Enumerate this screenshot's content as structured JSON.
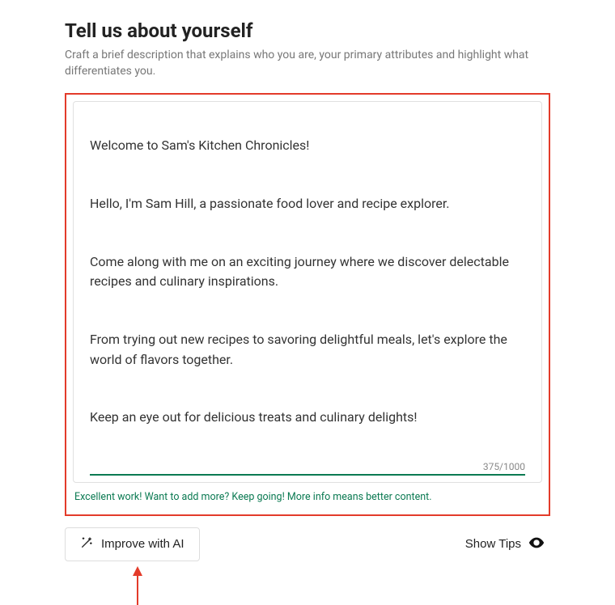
{
  "header": {
    "title": "Tell us about yourself",
    "subtitle": "Craft a brief description that explains who you are, your primary attributes and highlight what differentiates you."
  },
  "editor": {
    "paragraphs": [
      "Welcome to Sam's Kitchen Chronicles!",
      "Hello, I'm Sam Hill, a passionate food lover and recipe explorer.",
      "Come along with me on an exciting journey where we discover delectable recipes and culinary inspirations.",
      "From trying out new recipes to savoring delightful meals, let's explore the world of flavors together.",
      "Keep an eye out for delicious treats and culinary delights!"
    ],
    "char_count": "375/1000",
    "feedback": "Excellent work! Want to add more? Keep going! More info means better content."
  },
  "actions": {
    "improve_label": "Improve with AI",
    "tips_label": "Show Tips"
  }
}
